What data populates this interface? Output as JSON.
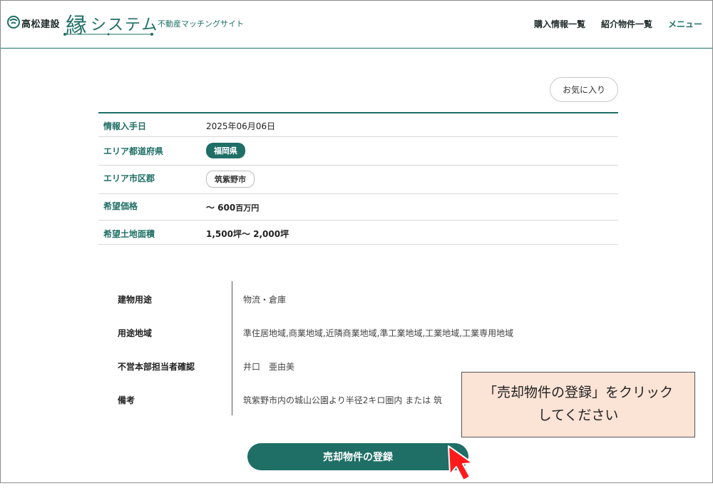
{
  "header": {
    "company": "高松建設",
    "brand_char": "縁",
    "brand_system": "システム",
    "tagline": "不動産マッチングサイト",
    "nav": [
      {
        "label": "購入情報一覧"
      },
      {
        "label": "紹介物件一覧"
      },
      {
        "label": "メニュー"
      }
    ]
  },
  "favorite_label": "お気に入り",
  "info": {
    "date": {
      "label": "情報入手日",
      "value": "2025年06月06日"
    },
    "prefecture": {
      "label": "エリア都道府県",
      "value": "福岡県"
    },
    "city": {
      "label": "エリア市区郡",
      "value": "筑紫野市"
    },
    "price": {
      "label": "希望価格",
      "prefix": "～ 600",
      "unit": "百万円"
    },
    "land": {
      "label": "希望土地面積",
      "value": "1,500坪～ 2,000坪"
    }
  },
  "details": [
    {
      "label": "建物用途",
      "value": "物流・倉庫"
    },
    {
      "label": "用途地域",
      "value": "準住居地域,商業地域,近隣商業地域,準工業地域,工業地域,工業専用地域"
    },
    {
      "label": "不営本部担当者確認",
      "value": "井口　亜由美"
    },
    {
      "label": "備考",
      "value": "筑紫野市内の城山公園より半径2キロ圏内 または 筑"
    }
  ],
  "register_label": "売却物件の登録",
  "callout": {
    "line1": "「売却物件の登録」をクリック",
    "line2": "してください"
  },
  "colors": {
    "brand": "#1f6f66",
    "price": "#e07a1a",
    "callout_bg": "#fbe3d6",
    "cursor": "#ff1a1a"
  }
}
